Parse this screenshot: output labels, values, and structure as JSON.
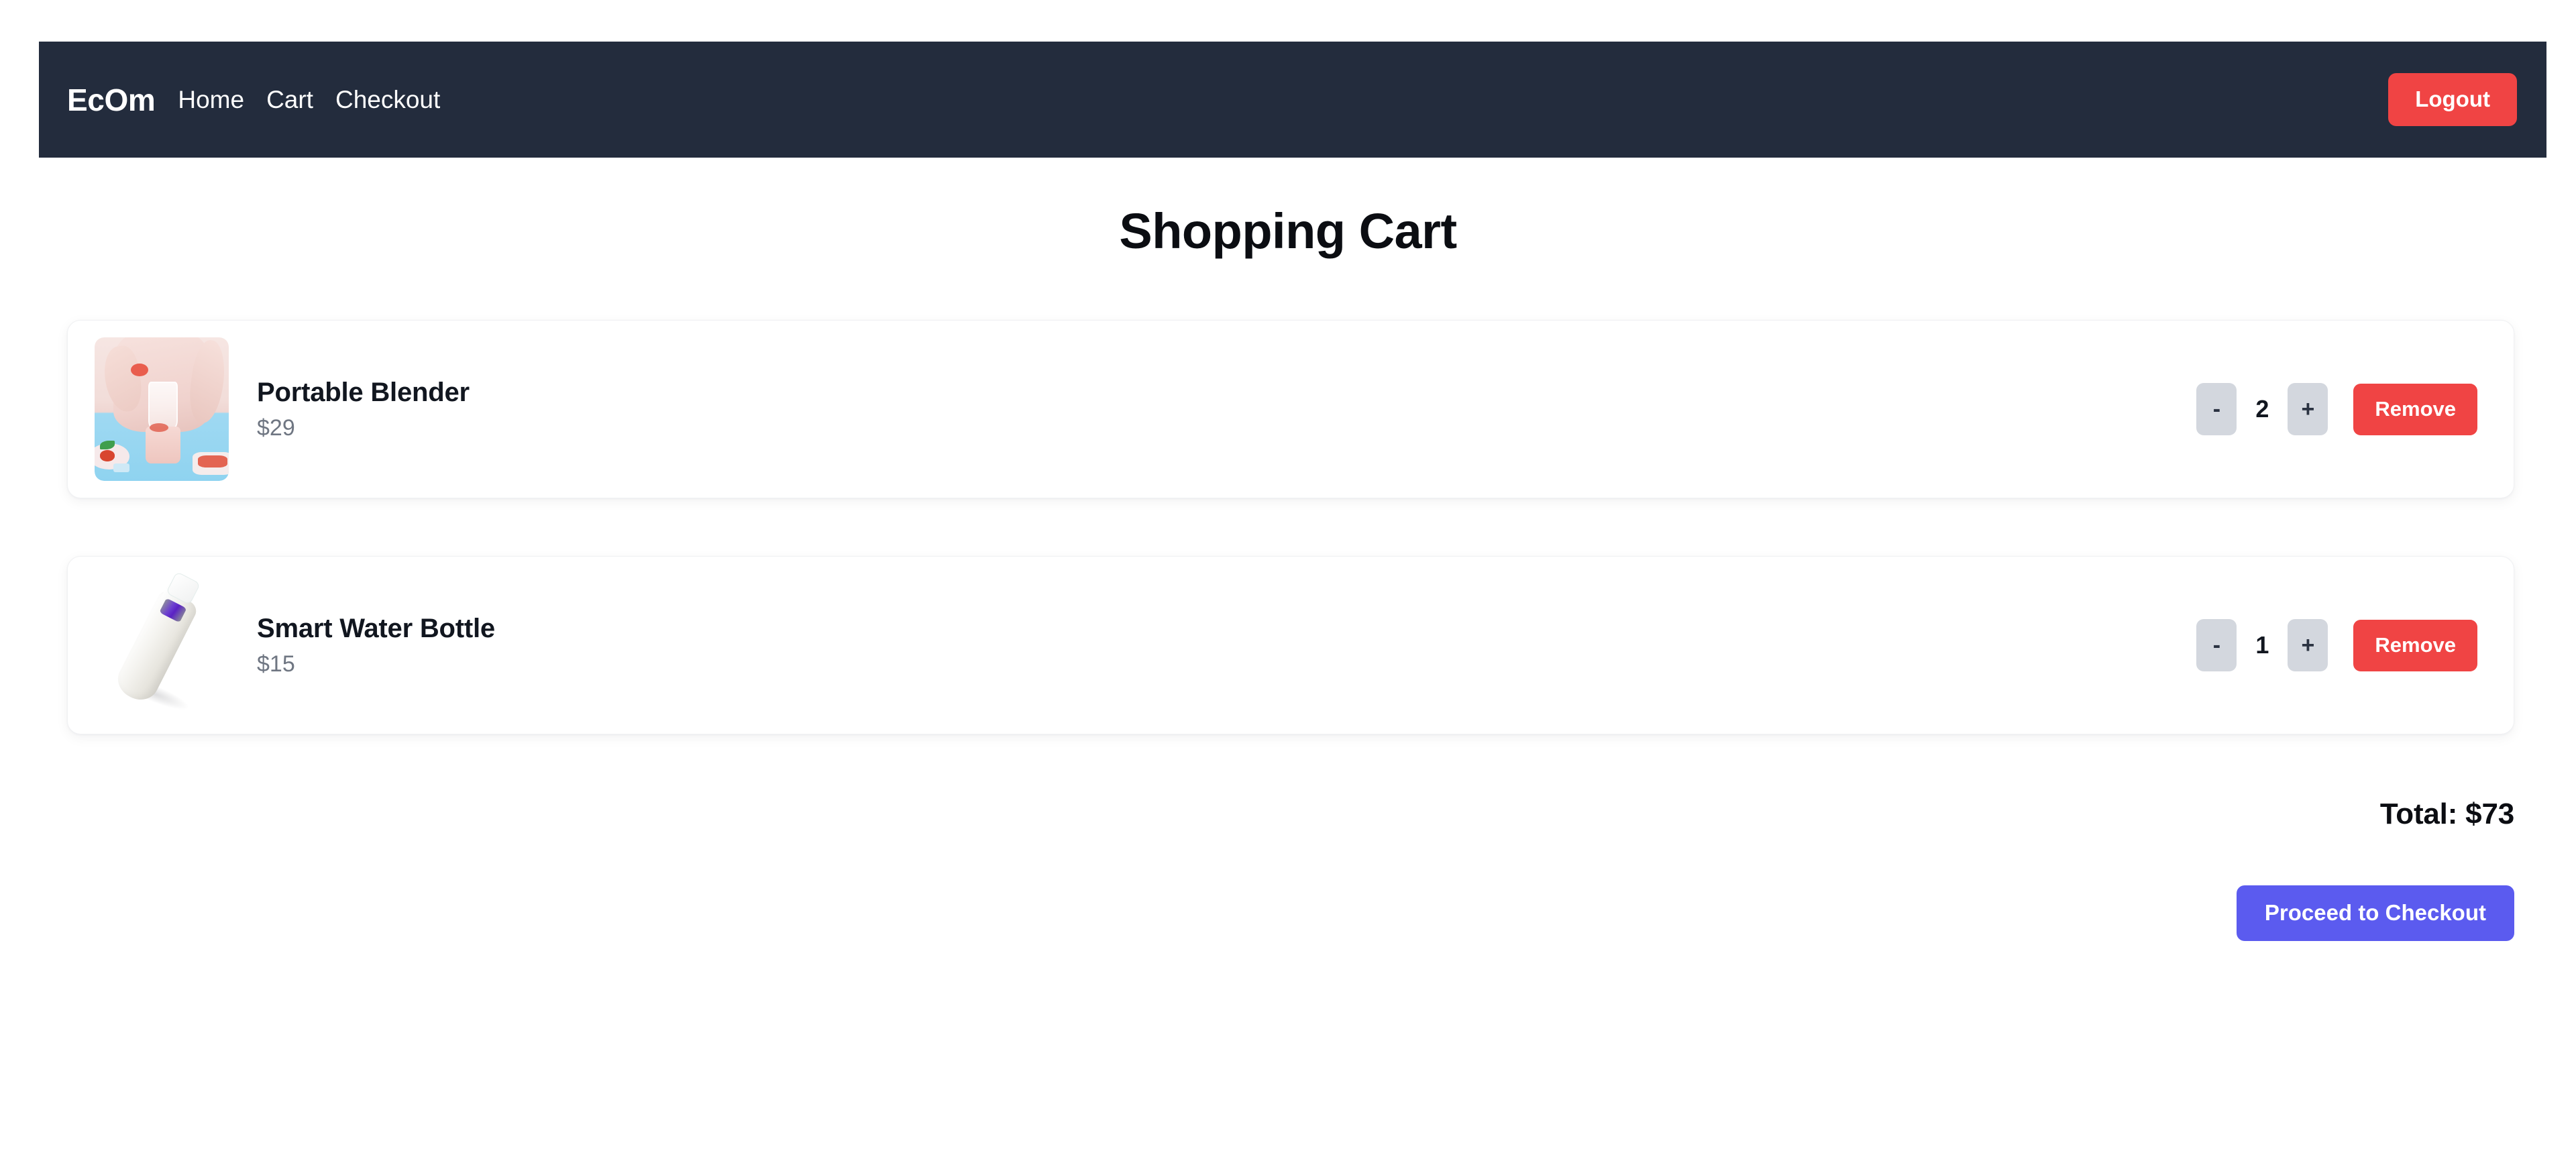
{
  "navbar": {
    "brand": "EcOm",
    "links": [
      {
        "label": "Home"
      },
      {
        "label": "Cart"
      },
      {
        "label": "Checkout"
      }
    ],
    "logout_label": "Logout",
    "background_color": "#232c3d",
    "logout_color": "#f04444"
  },
  "page": {
    "title": "Shopping Cart"
  },
  "cart": {
    "items": [
      {
        "name": "Portable Blender",
        "price": "$29",
        "quantity": "2",
        "decrement_label": "-",
        "increment_label": "+",
        "remove_label": "Remove",
        "image_name": "portable-blender-photo"
      },
      {
        "name": "Smart Water Bottle",
        "price": "$15",
        "quantity": "1",
        "decrement_label": "-",
        "increment_label": "+",
        "remove_label": "Remove",
        "image_name": "smart-water-bottle-photo"
      }
    ]
  },
  "summary": {
    "total_label": "Total: $73",
    "checkout_label": "Proceed to Checkout",
    "checkout_color": "#5b5bef"
  }
}
